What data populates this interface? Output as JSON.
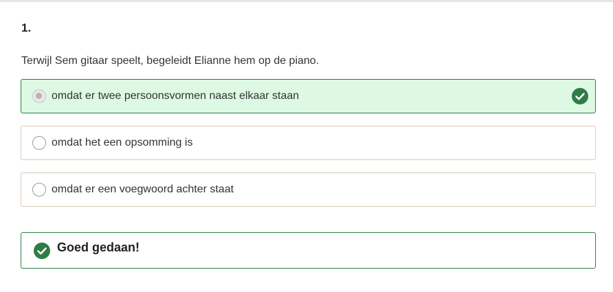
{
  "question": {
    "number": "1.",
    "text": "Terwijl Sem gitaar speelt, begeleidt Elianne hem op de piano."
  },
  "options": [
    {
      "label": "omdat er twee persoonsvormen naast elkaar staan",
      "state": "correct"
    },
    {
      "label": "omdat het een opsomming is",
      "state": "unselected"
    },
    {
      "label": "omdat er een voegwoord achter staat",
      "state": "unselected"
    }
  ],
  "feedback": {
    "text": "Goed gedaan!",
    "icon": "check-circle-icon"
  },
  "colors": {
    "success": "#2e7d46",
    "correct_background": "#ddf9e3",
    "option_border": "#d9cbb8"
  }
}
